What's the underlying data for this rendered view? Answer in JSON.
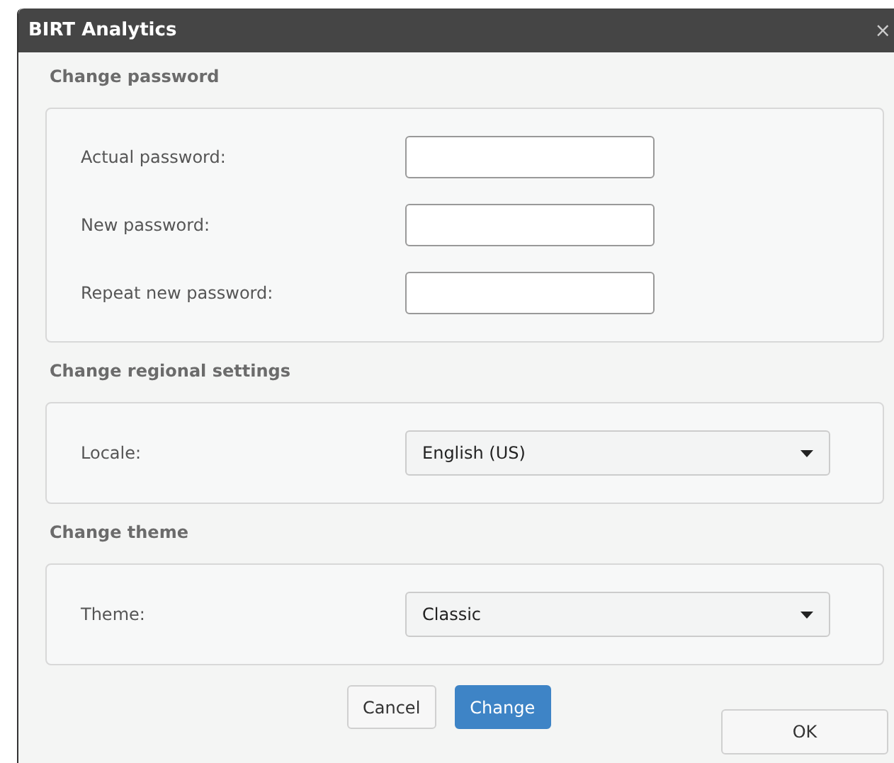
{
  "window": {
    "title": "BIRT Analytics",
    "close": "×"
  },
  "sections": [
    {
      "heading": "Change password",
      "rows": [
        {
          "kind": "password",
          "label": "Actual password:"
        },
        {
          "kind": "password",
          "label": "New password:"
        },
        {
          "kind": "password",
          "label": "Repeat new password:"
        }
      ]
    },
    {
      "heading": "Change regional settings",
      "rows": [
        {
          "kind": "select",
          "label": "Locale:",
          "value": "English (US)"
        }
      ]
    },
    {
      "heading": "Change theme",
      "rows": [
        {
          "kind": "select",
          "label": "Theme:",
          "value": "Classic"
        }
      ]
    }
  ],
  "actions": [
    {
      "label": "Cancel",
      "primary": false
    },
    {
      "label": "Change",
      "primary": true
    }
  ],
  "ok": "OK"
}
